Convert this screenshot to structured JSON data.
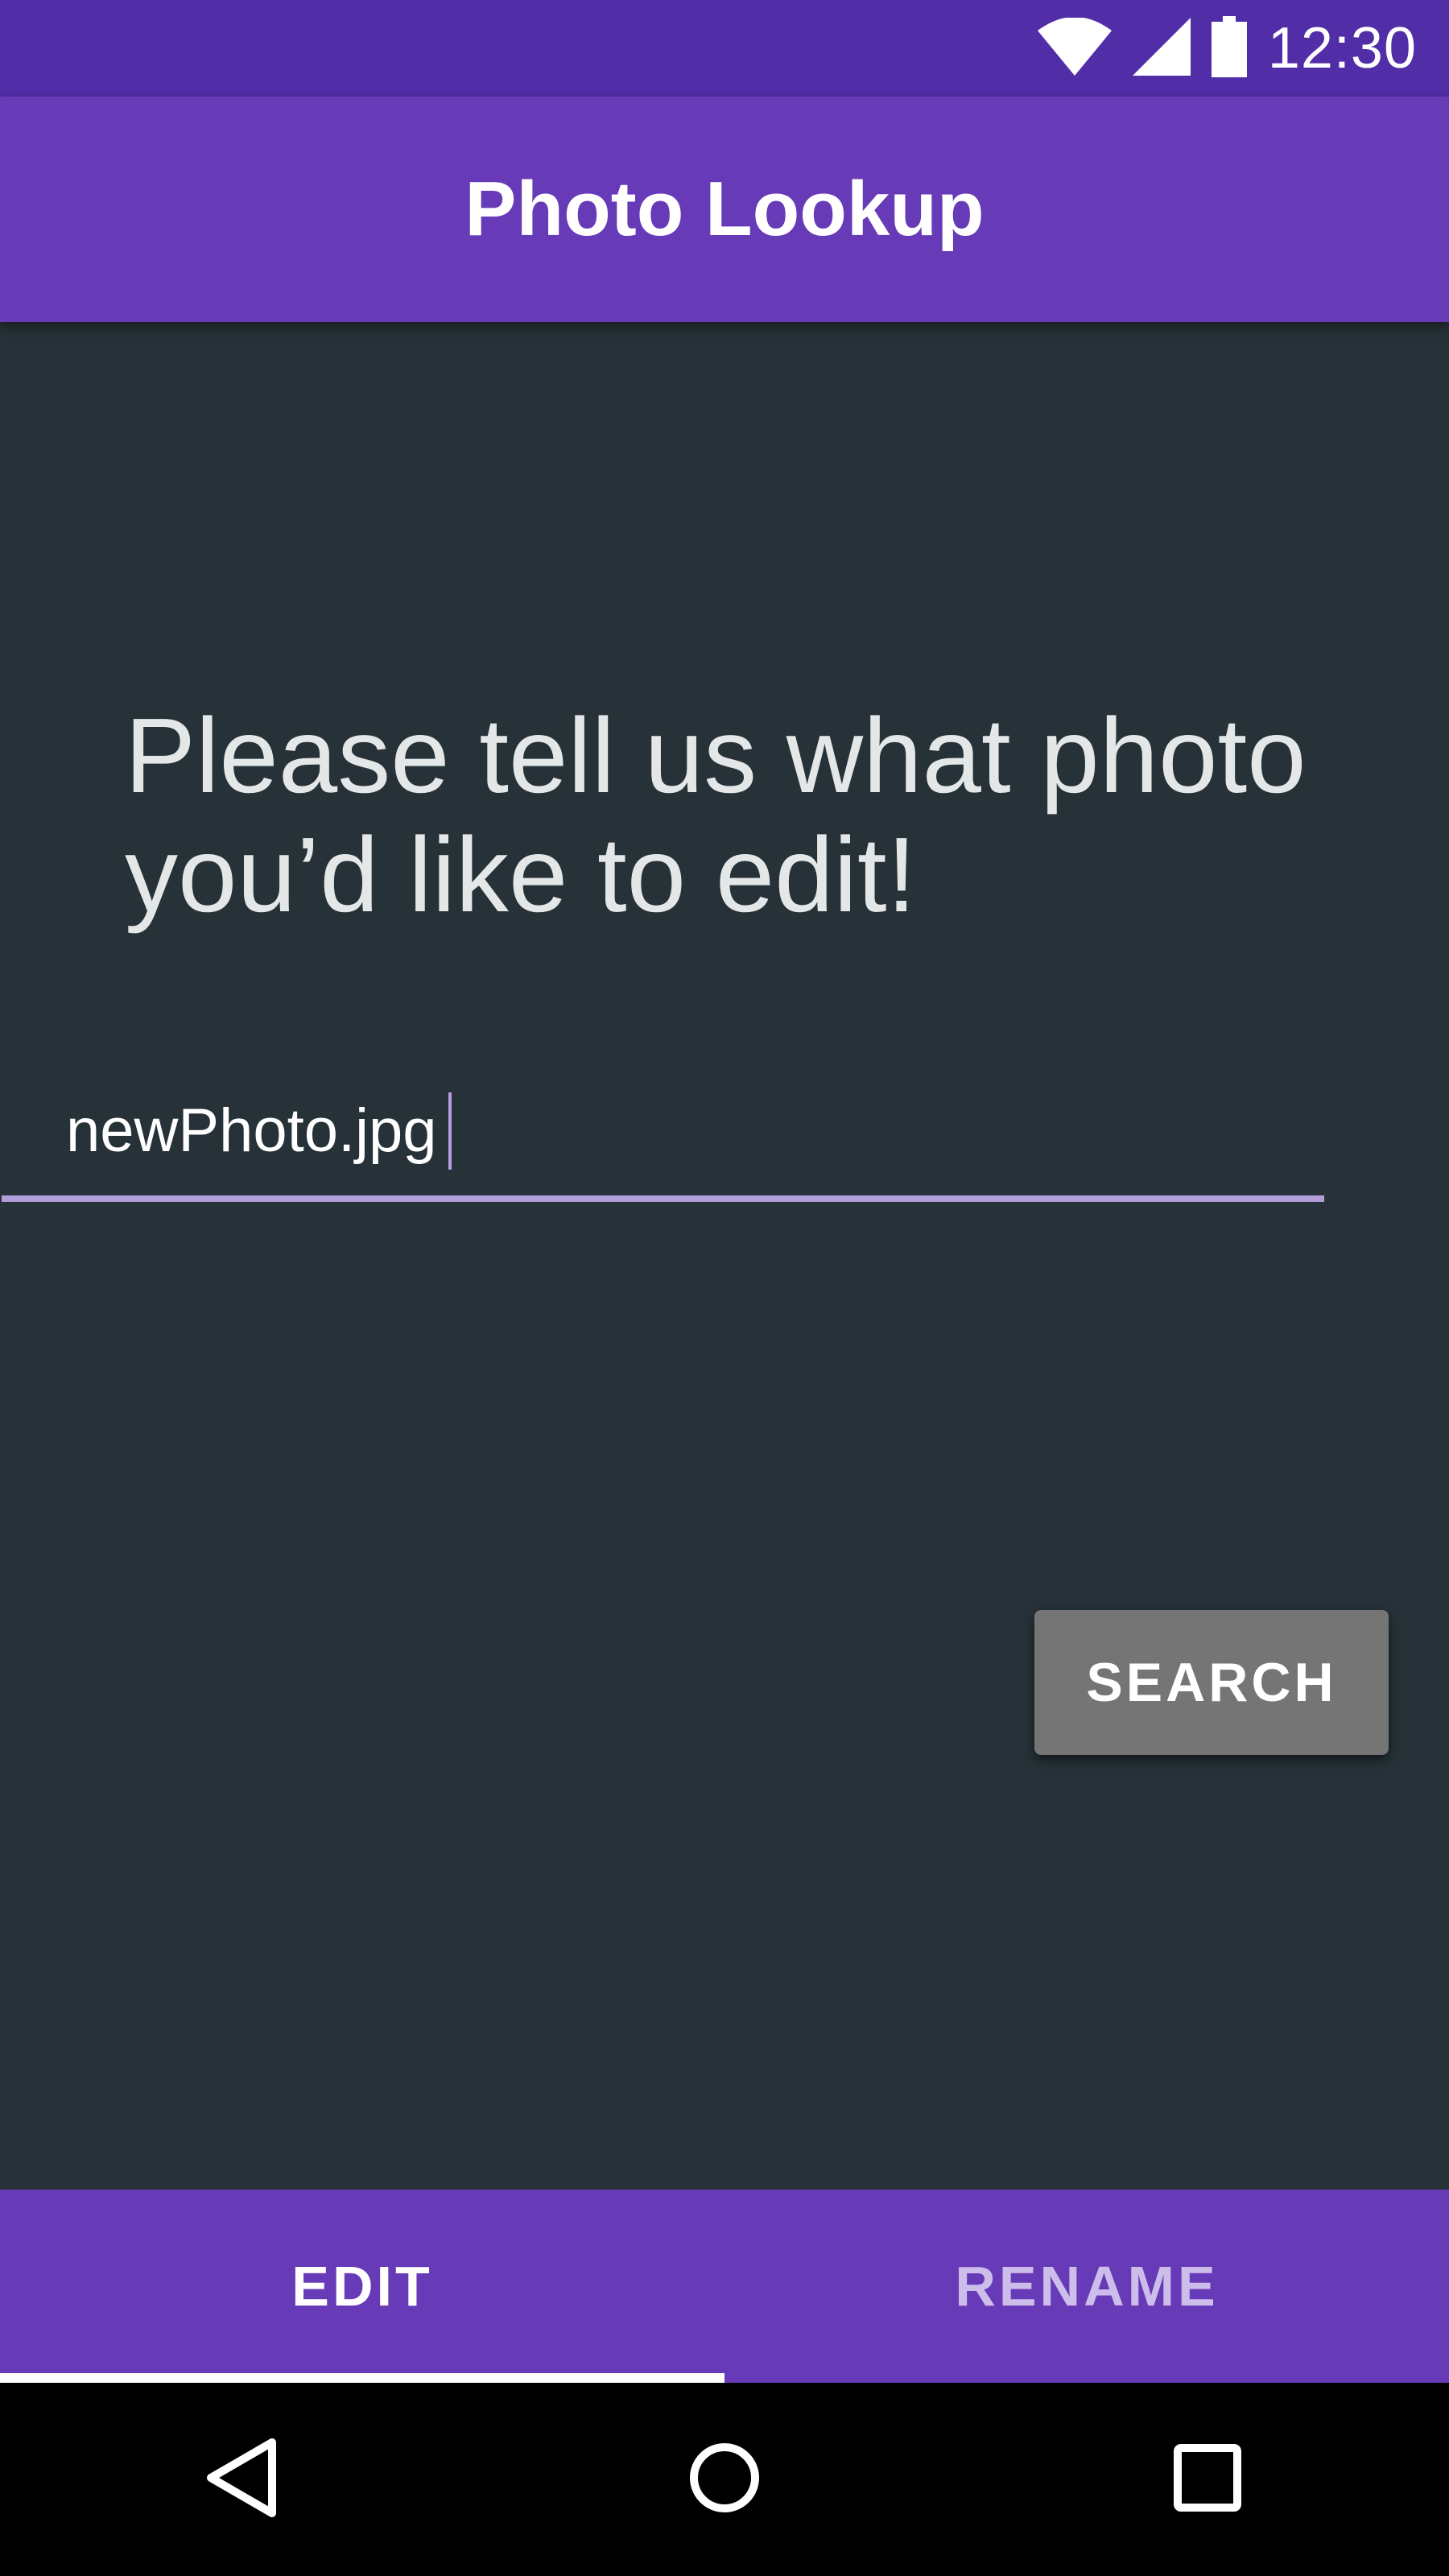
{
  "status_bar": {
    "time": "12:30",
    "icons": [
      "wifi-icon",
      "cellular-signal-icon",
      "battery-icon"
    ]
  },
  "app_bar": {
    "title": "Photo Lookup"
  },
  "main": {
    "prompt": "Please tell us what photo you’d like to edit!",
    "search_input": {
      "value": "newPhoto.jpg",
      "placeholder": ""
    },
    "search_button_label": "SEARCH"
  },
  "tabs": [
    {
      "label": "EDIT",
      "selected": true
    },
    {
      "label": "RENAME",
      "selected": false
    }
  ],
  "nav_bar": {
    "icons": [
      "back-icon",
      "home-icon",
      "recents-icon"
    ]
  },
  "colors": {
    "status_bar": "#512DA8",
    "primary": "#673AB7",
    "background": "#263238",
    "accent": "#B39DDB",
    "button": "#757575"
  }
}
